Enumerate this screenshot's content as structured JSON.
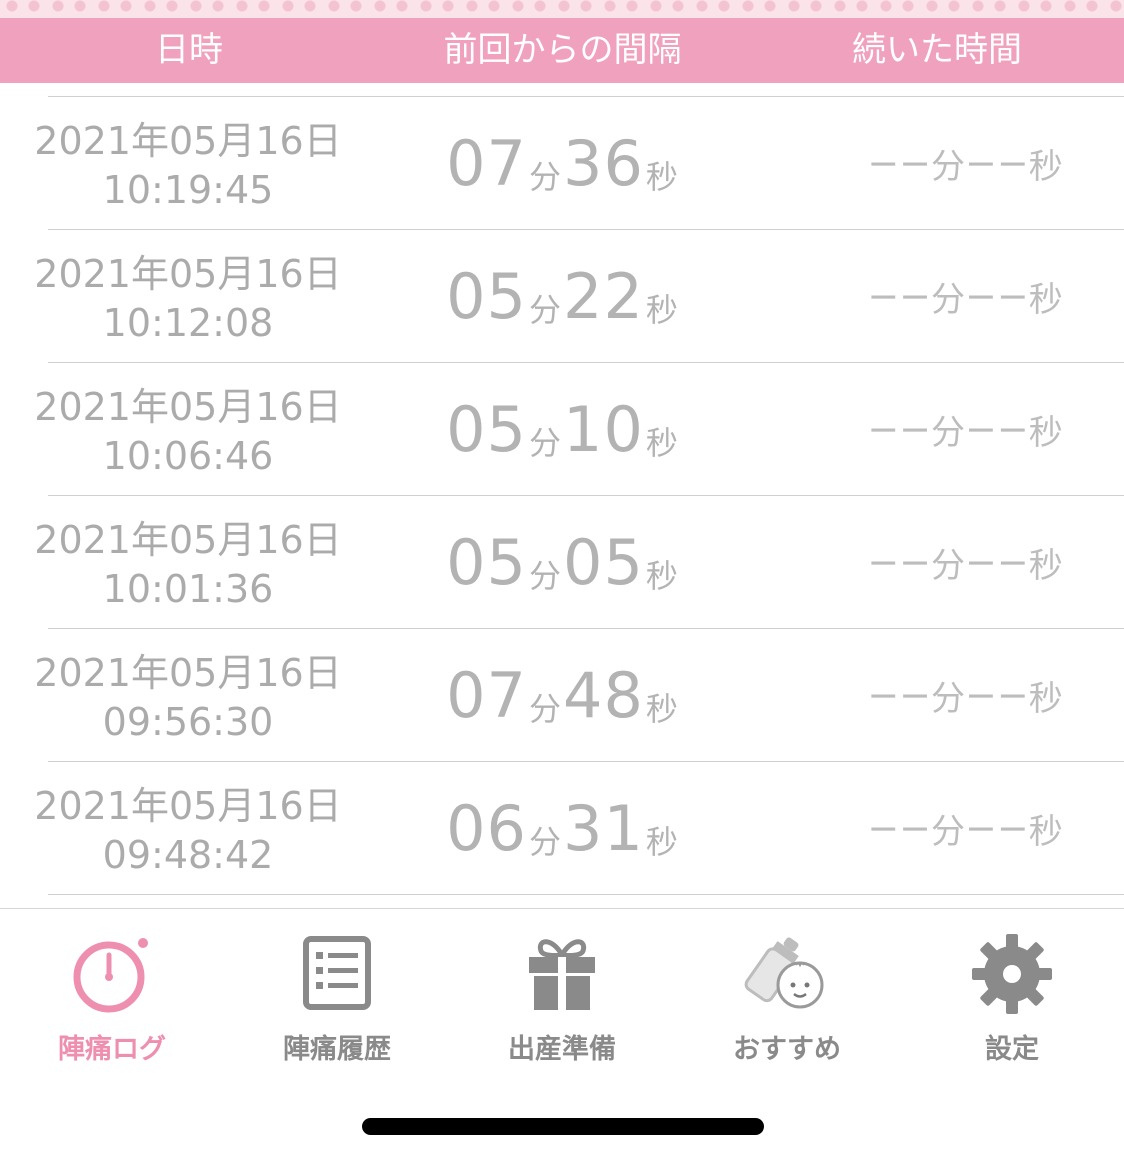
{
  "header": {
    "col_datetime": "日時",
    "col_interval": "前回からの間隔",
    "col_duration": "続いた時間"
  },
  "rows": [
    {
      "date": "2021年05月16日",
      "time": "10:19:45",
      "interval_min": "07",
      "interval_sec": "36",
      "duration_min": "−−",
      "duration_sec": "−−"
    },
    {
      "date": "2021年05月16日",
      "time": "10:12:08",
      "interval_min": "05",
      "interval_sec": "22",
      "duration_min": "−−",
      "duration_sec": "−−"
    },
    {
      "date": "2021年05月16日",
      "time": "10:06:46",
      "interval_min": "05",
      "interval_sec": "10",
      "duration_min": "−−",
      "duration_sec": "−−"
    },
    {
      "date": "2021年05月16日",
      "time": "10:01:36",
      "interval_min": "05",
      "interval_sec": "05",
      "duration_min": "−−",
      "duration_sec": "−−"
    },
    {
      "date": "2021年05月16日",
      "time": "09:56:30",
      "interval_min": "07",
      "interval_sec": "48",
      "duration_min": "−−",
      "duration_sec": "−−"
    },
    {
      "date": "2021年05月16日",
      "time": "09:48:42",
      "interval_min": "06",
      "interval_sec": "31",
      "duration_min": "−−",
      "duration_sec": "−−"
    }
  ],
  "units": {
    "minute": "分",
    "second": "秒"
  },
  "nav": [
    {
      "label": "陣痛ログ",
      "icon": "stopwatch-icon",
      "active": true
    },
    {
      "label": "陣痛履歴",
      "icon": "list-icon",
      "active": false
    },
    {
      "label": "出産準備",
      "icon": "gift-icon",
      "active": false
    },
    {
      "label": "おすすめ",
      "icon": "baby-bottle-icon",
      "active": false
    },
    {
      "label": "設定",
      "icon": "gear-icon",
      "active": false
    }
  ],
  "colors": {
    "accent_pink": "#f0a1bd",
    "active_pink": "#ee8fb0",
    "text_gray": "#ababab",
    "icon_gray": "#8a8a8a"
  }
}
